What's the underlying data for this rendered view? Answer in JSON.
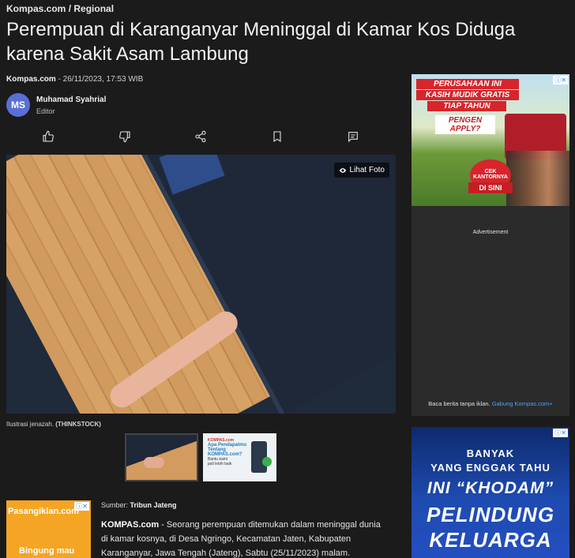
{
  "breadcrumb": {
    "site": "Kompas.com",
    "sep": " / ",
    "section": "Regional"
  },
  "article": {
    "title": "Perempuan di Karanganyar Meninggal di Kamar Kos Diduga karena Sakit Asam Lambung",
    "publisher": "Kompas.com",
    "datetime": " - 26/11/2023, 17:53 WIB",
    "author": {
      "initials": "MS",
      "name": "Muhamad Syahrial",
      "role": "Editor"
    },
    "lihat_foto": "Lihat Foto",
    "caption": "Ilustrasi jenazah.",
    "caption_credit": "(THINKSTOCK)",
    "source_label": "Sumber: ",
    "source_name": "Tribun Jateng",
    "lead_bold": "KOMPAS.com",
    "lead_text": " - Seorang perempuan ditemukan dalam meninggal dunia di kamar kosnya, di Desa Ngringo, Kecamatan Jaten, Kabupaten Karanganyar, Jawa Tengah (Jateng), Sabtu (25/11/2023) malam."
  },
  "actions": {
    "icons": [
      "thumbs-up-icon",
      "thumbs-down-icon",
      "share-icon",
      "bookmark-icon",
      "comment-icon"
    ]
  },
  "thumb_ad": {
    "brand": "KOMPAS.com",
    "line1": "Apa Pendapatmu",
    "line2": "Tentang",
    "line3": "KOMPAS.com?",
    "line4": "Bantu kami",
    "line5": "jadi lebih baik"
  },
  "ads": {
    "left": {
      "brand": "Pasangiklan.com",
      "text": "Bingung mau"
    },
    "sidebar1": {
      "line1": "PERUSAHAAN INI",
      "line2": "KASIH MUDIK GRATIS",
      "line3": "TIAP TAHUN",
      "line4": "PENGEN APPLY?",
      "cek": "CEK KANTORNYA",
      "disini": "DI SINI"
    },
    "advertisement_label": "Advertisement",
    "no_ads_text": "Baca berita tanpa iklan. ",
    "no_ads_link": "Gabung Kompas.com+",
    "sidebar2": {
      "line1": "BANYAK",
      "line2": "YANG ENGGAK TAHU",
      "line3": "INI “KHODAM”",
      "line4": "PELINDUNG",
      "line5": "KELUARGA"
    },
    "close_label": "ⓘ✕"
  }
}
